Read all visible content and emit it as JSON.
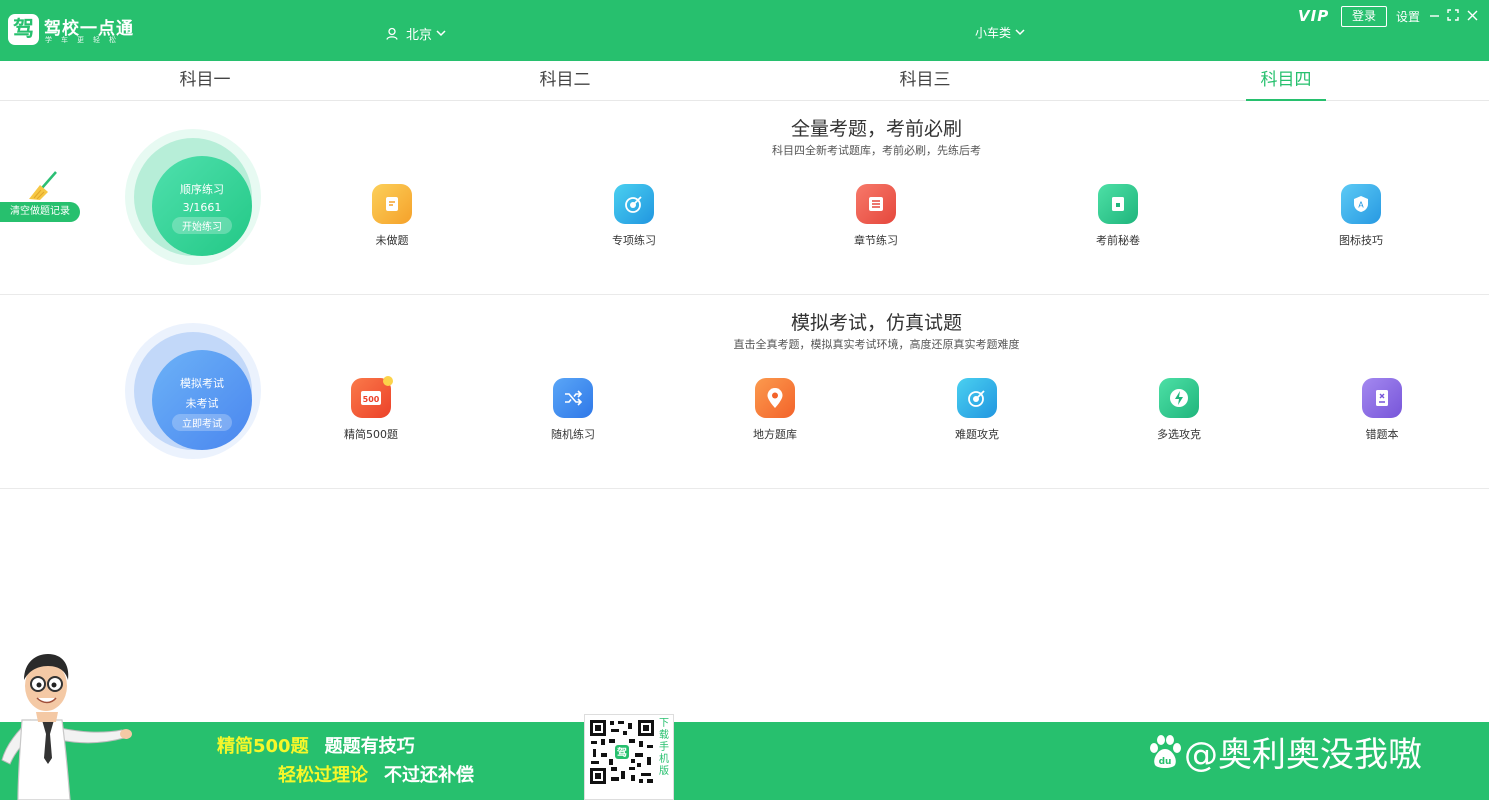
{
  "header": {
    "logo_char": "驾",
    "app_name": "驾校一点通",
    "slogan": "学车更轻松",
    "city": "北京",
    "car_type": "小车类",
    "vip": "VIP",
    "login": "登录",
    "settings": "设置"
  },
  "tabs": [
    {
      "label": "科目一"
    },
    {
      "label": "科目二"
    },
    {
      "label": "科目三"
    },
    {
      "label": "科目四",
      "active": true
    }
  ],
  "clear_records": "清空做题记录",
  "practice": {
    "title": "全量考题，考前必刷",
    "subtitle": "科目四全新考试题库，考前必刷，先练后考",
    "circle": {
      "line1": "顺序练习",
      "line2": "3/1661",
      "button": "开始练习"
    },
    "items": [
      {
        "label": "未做题",
        "icon": "notepad-icon",
        "color": "#f8b73a"
      },
      {
        "label": "专项练习",
        "icon": "target-icon",
        "color": "#2fb5e6"
      },
      {
        "label": "章节练习",
        "icon": "list-icon",
        "color": "#ef5a4d"
      },
      {
        "label": "考前秘卷",
        "icon": "secret-book-icon",
        "color": "#25c78c"
      },
      {
        "label": "图标技巧",
        "icon": "shield-a-icon",
        "color": "#3eb3ec"
      }
    ]
  },
  "exam": {
    "title": "模拟考试，仿真试题",
    "subtitle": "直击全真考题，模拟真实考试环境，高度还原真实考题难度",
    "circle": {
      "line1": "模拟考试",
      "line2": "未考试",
      "button": "立即考试"
    },
    "items": [
      {
        "label": "精简500题",
        "icon": "500-icon",
        "color": "#f35b3a",
        "badge": "500"
      },
      {
        "label": "随机练习",
        "icon": "shuffle-icon",
        "color": "#3a8cf0"
      },
      {
        "label": "地方题库",
        "icon": "location-pin-icon",
        "color": "#f7783a"
      },
      {
        "label": "难题攻克",
        "icon": "target-icon",
        "color": "#2fb5e6"
      },
      {
        "label": "多选攻克",
        "icon": "lightning-icon",
        "color": "#25c78c"
      },
      {
        "label": "错题本",
        "icon": "error-book-icon",
        "color": "#8b6be0"
      }
    ]
  },
  "banner": {
    "line1_a": "精简500题",
    "line1_b": "题题有技巧",
    "line2_a": "轻松过理论",
    "line2_b": "不过还补偿",
    "qr_text": [
      "下",
      "载",
      "手",
      "机",
      "版"
    ],
    "qr_center": "驾",
    "watermark": "@奥利奥没我嗷",
    "watermark_logo": "du"
  }
}
